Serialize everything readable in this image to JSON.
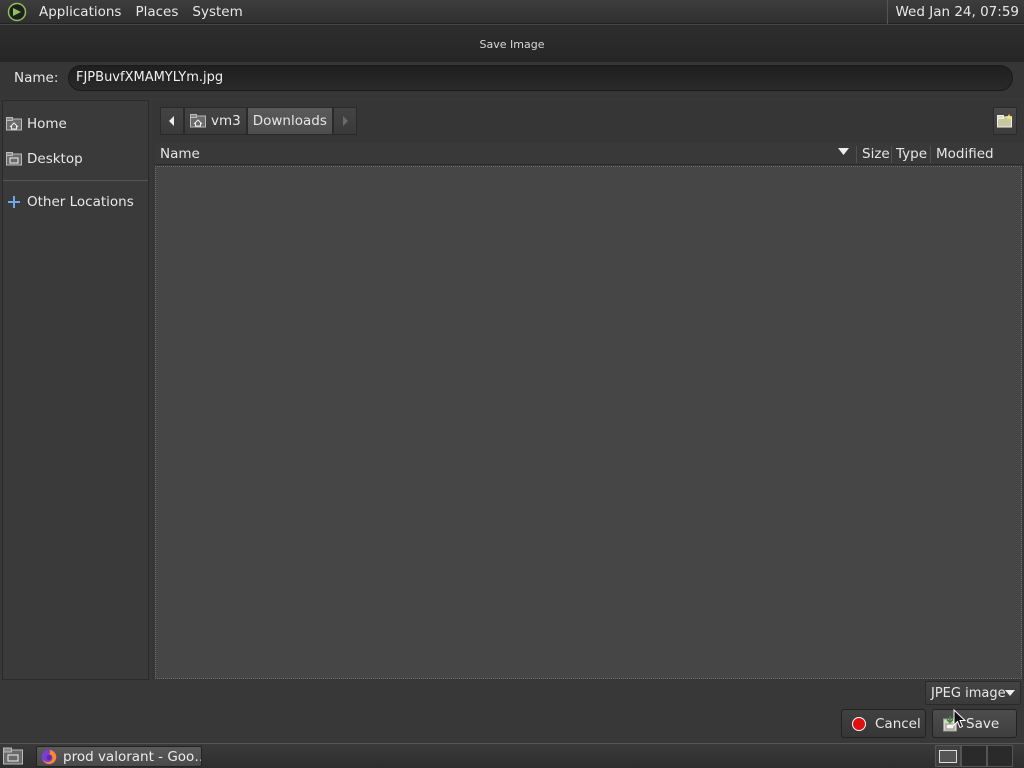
{
  "top_panel": {
    "menus": [
      "Applications",
      "Places",
      "System"
    ],
    "clock": "Wed Jan 24, 07:59"
  },
  "dialog": {
    "title": "Save Image",
    "name_label": "Name:",
    "filename": "FJPBuvfXMAMYLYm.jpg"
  },
  "sidebar": {
    "places": [
      {
        "label": "Home",
        "icon": "home-folder-icon"
      },
      {
        "label": "Desktop",
        "icon": "desktop-folder-icon"
      },
      {
        "label": "Other Locations",
        "icon": "plus-icon"
      }
    ]
  },
  "pathbar": {
    "segments": [
      "vm3",
      "Downloads"
    ],
    "active": "Downloads"
  },
  "file_list": {
    "columns": [
      "Name",
      "Size",
      "Type",
      "Modified"
    ],
    "sorted_by": "Name",
    "rows": []
  },
  "bottom": {
    "file_type": "JPEG image",
    "cancel_label": "Cancel",
    "save_label": "Save"
  },
  "taskbar": {
    "window_title": "prod valorant - Goo…"
  }
}
